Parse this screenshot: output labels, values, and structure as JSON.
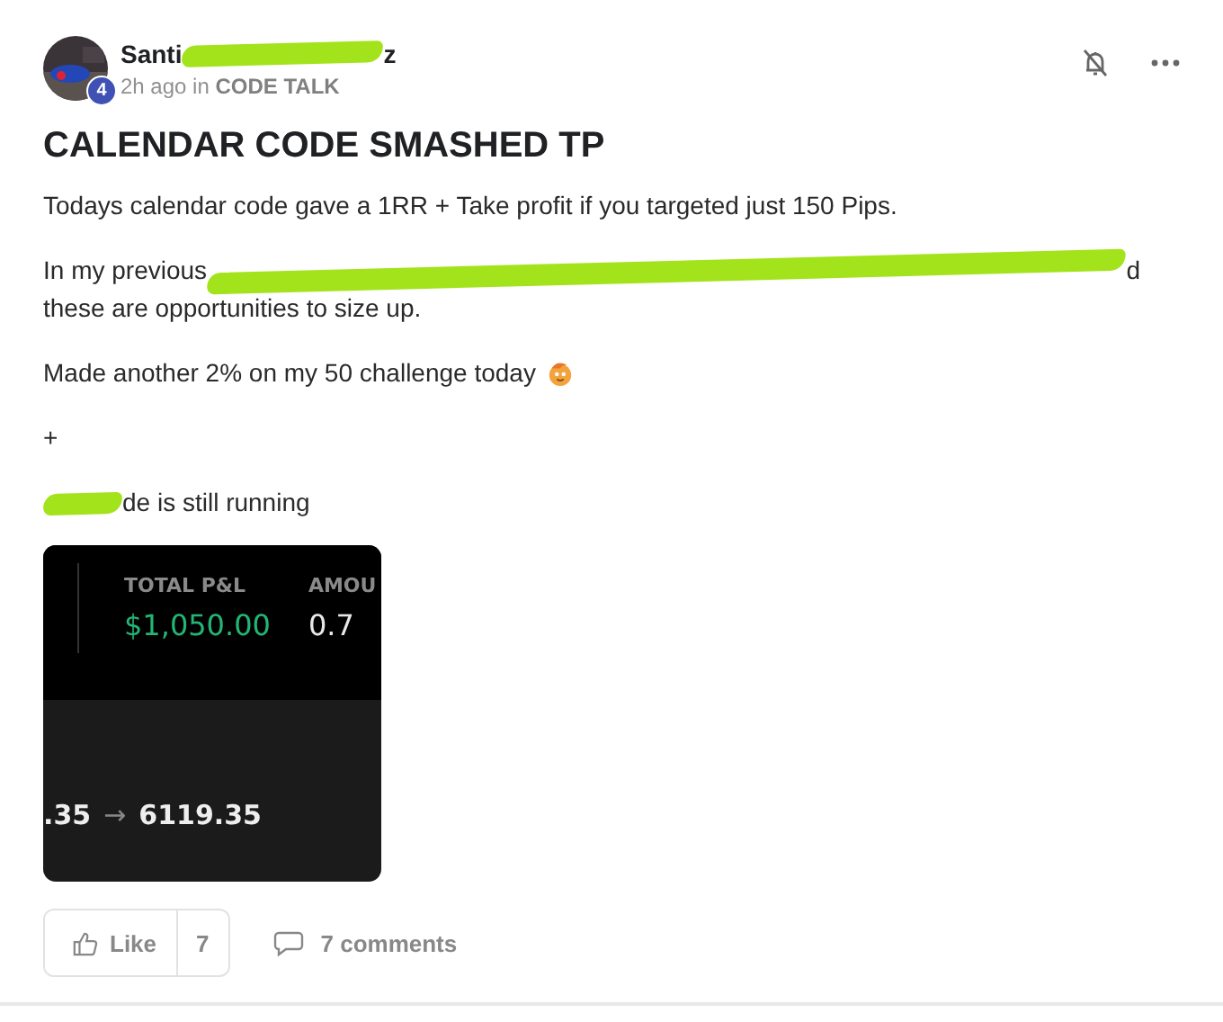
{
  "author": {
    "name_parts": [
      {
        "kind": "text",
        "text": "Santi"
      },
      {
        "kind": "redaction"
      },
      {
        "kind": "text",
        "text": "z"
      }
    ],
    "badge": "4",
    "meta": "2h ago in **CODE TALK**"
  },
  "title": "CALENDAR CODE SMASHED TP",
  "paragraphs": [
    [
      [
        {
          "kind": "text",
          "text": "Todays calendar code gave a 1RR + Take profit if you targeted just 150 Pips."
        }
      ]
    ],
    [
      [
        {
          "kind": "text",
          "text": "In my previous"
        },
        {
          "kind": "redaction"
        },
        {
          "kind": "text",
          "text": "d"
        }
      ],
      [
        {
          "kind": "text",
          "text": "these are opportunities to size up."
        }
      ]
    ],
    [
      [
        {
          "kind": "text",
          "text": "Made another 2% on my 50 challenge today"
        },
        {
          "kind": "emoji"
        }
      ]
    ],
    [
      [
        {
          "kind": "text",
          "text": "+"
        }
      ]
    ],
    [
      [
        {
          "kind": "redaction"
        },
        {
          "kind": "text",
          "text": "de is still running"
        }
      ]
    ]
  ],
  "screenshot": {
    "total_label": "TOTAL P&L",
    "total_value": "$1,050.00",
    "amount_label": "AMOU",
    "amount_value": "0.7",
    "price_from": ".35",
    "arrow": "→",
    "price_to": "6119.35"
  },
  "footer": {
    "like_label": "Like",
    "like_count": "7",
    "comments": "7 comments"
  }
}
